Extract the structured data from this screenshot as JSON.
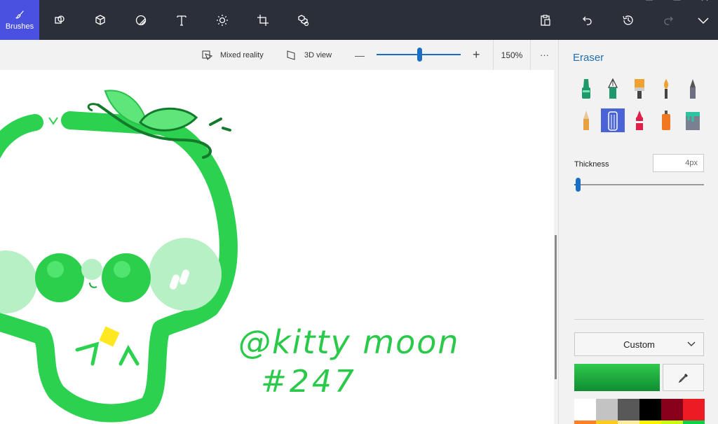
{
  "toolbar": {
    "active_tool_label": "Brushes",
    "tools": [
      "brushes",
      "2d-shapes",
      "3d-shapes",
      "stickers",
      "text",
      "effects",
      "crop",
      "3d-library"
    ],
    "right_actions": [
      "paste",
      "undo",
      "history",
      "redo",
      "expand-menu"
    ]
  },
  "subbar": {
    "mixed_reality_label": "Mixed reality",
    "view_3d_label": "3D view",
    "zoom_out_symbol": "—",
    "zoom_in_symbol": "+",
    "zoom_value": "150%",
    "zoom_level_fraction": 0.5,
    "more_symbol": "···"
  },
  "canvas": {
    "signature_line1": "@kitty moon",
    "signature_line2": "#247"
  },
  "panel": {
    "title": "Eraser",
    "brushes": [
      "marker",
      "calligraphy-pen",
      "oil-brush",
      "watercolor",
      "pixel-pen",
      "pencil",
      "eraser",
      "crayon",
      "spray-can",
      "fill"
    ],
    "selected_brush": "eraser",
    "thickness_label": "Thickness",
    "thickness_value": "4px",
    "thickness_fraction": 0.02,
    "color_mode": "Custom",
    "current_color": "#2fc94d",
    "palette": [
      "#ffffff",
      "#c3c3c3",
      "#585858",
      "#000000",
      "#88001b",
      "#ec1c24"
    ],
    "palette_row2": [
      "#ff7f27",
      "#ffca18",
      "#fdeca6",
      "#fff200",
      "#c4ff0e",
      "#0ed145"
    ]
  }
}
